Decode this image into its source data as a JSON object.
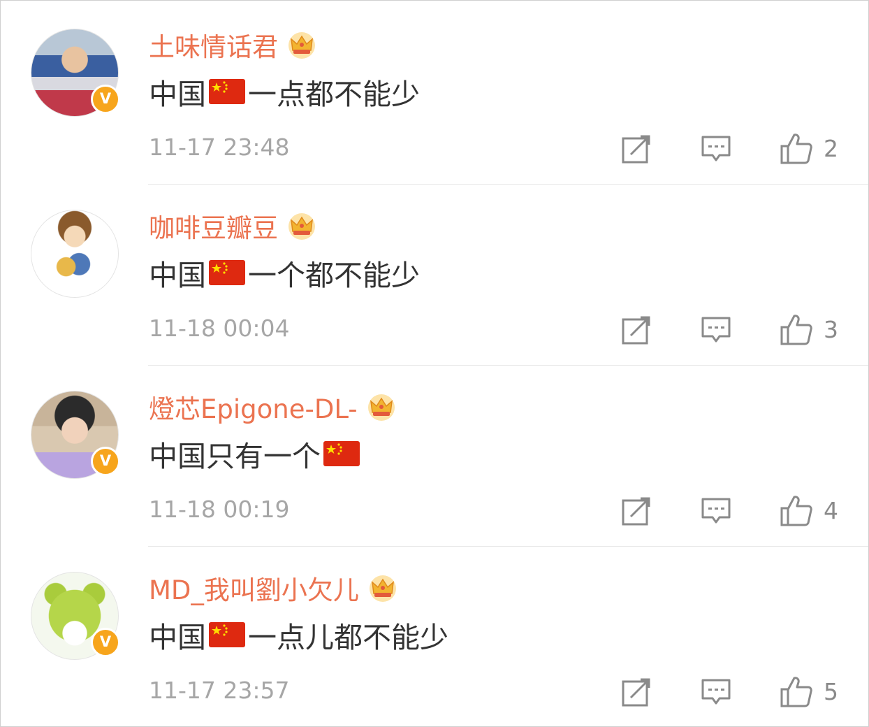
{
  "comments": [
    {
      "username": "土味情话君",
      "text_before": "中国",
      "text_after": "一点都不能少",
      "timestamp": "11-17 23:48",
      "likes": "2",
      "verified": true,
      "verified_mark": "V"
    },
    {
      "username": "咖啡豆瓣豆",
      "text_before": "中国",
      "text_after": "一个都不能少",
      "timestamp": "11-18 00:04",
      "likes": "3",
      "verified": false
    },
    {
      "username": "燈芯Epigone-DL-",
      "text_before": "中国只有一个",
      "text_after": "",
      "timestamp": "11-18 00:19",
      "likes": "4",
      "verified": true,
      "verified_mark": "V"
    },
    {
      "username": "MD_我叫劉小欠儿",
      "text_before": "中国",
      "text_after": "一点儿都不能少",
      "timestamp": "11-17 23:57",
      "likes": "5",
      "verified": true,
      "verified_mark": "V"
    }
  ],
  "icons": {
    "badge": "crown-icon",
    "flag": "china-flag-emoji",
    "forward": "forward-icon",
    "comment": "comment-icon",
    "like": "thumbs-up-icon"
  },
  "colors": {
    "username": "#eb7350",
    "text": "#333333",
    "timestamp": "#a6a6a6",
    "verified_badge": "#f7a51c",
    "flag_red": "#de2910",
    "flag_star": "#ffde00"
  }
}
